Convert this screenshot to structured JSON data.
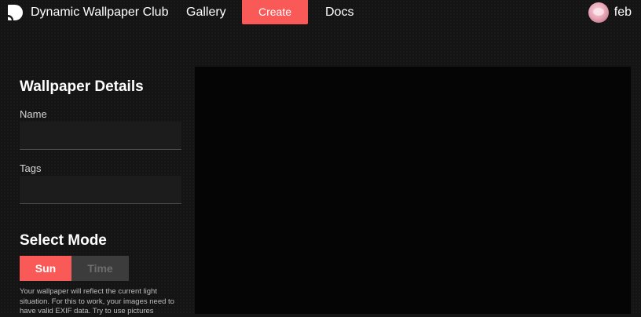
{
  "nav": {
    "brand_title": "Dynamic Wallpaper Club",
    "logo_icon": "dwc-logo-icon",
    "links": {
      "gallery": "Gallery",
      "create": "Create",
      "docs": "Docs"
    },
    "user_name": "feb"
  },
  "details": {
    "title": "Wallpaper Details",
    "name_label": "Name",
    "name_value": "",
    "tags_label": "Tags",
    "tags_value": ""
  },
  "mode": {
    "title": "Select Mode",
    "options": [
      "Sun",
      "Time"
    ],
    "selected": "Sun",
    "description": "Your wallpaper will reflect the current light situation. For this to work, your images need to have valid EXIF data. Try to use pictures"
  },
  "colors": {
    "accent": "#f95a57",
    "background": "#141414",
    "canvas": "#050505"
  }
}
